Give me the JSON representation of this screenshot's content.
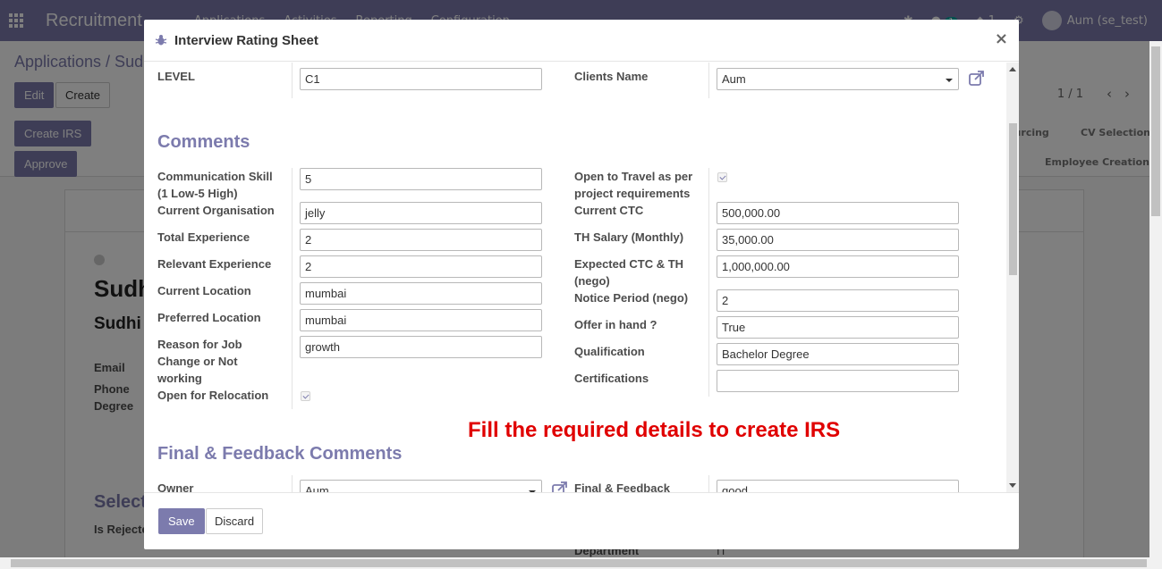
{
  "navbar": {
    "brand": "Recruitment",
    "menu": [
      "Applications",
      "Activities",
      "Reporting",
      "Configuration"
    ],
    "activity_count": "1",
    "message_count": "1",
    "user": "Aum (se_test)"
  },
  "control_panel": {
    "breadcrumb": "Applications / Sudh",
    "edit_label": "Edit",
    "create_label": "Create",
    "pager": "1 / 1",
    "create_irs_label": "Create IRS",
    "approve_label": "Approve",
    "stages": [
      "ourcing",
      "CV Selection",
      "Employee Creation"
    ]
  },
  "background_form": {
    "name_line1": "Sudh",
    "name_line2": "Sudhi",
    "email_label": "Email",
    "phone_label": "Phone",
    "degree_label": "Degree",
    "select_heading": "Select",
    "is_rejected_label": "Is Rejecte",
    "department_label": "Department",
    "department_value": "IT"
  },
  "modal": {
    "title": "Interview Rating Sheet",
    "close": "×",
    "level_label": "LEVEL",
    "level_value": "C1",
    "clients_name_label": "Clients Name",
    "clients_name_value": "Aum",
    "comments_title": "Comments",
    "left_fields": [
      {
        "label": "Communication Skill (1 Low-5 High)",
        "value": "5"
      },
      {
        "label": "Current Organisation",
        "value": "jelly"
      },
      {
        "label": "Total Experience",
        "value": "2"
      },
      {
        "label": "Relevant Experience",
        "value": "2"
      },
      {
        "label": "Current Location",
        "value": "mumbai"
      },
      {
        "label": "Preferred Location",
        "value": "mumbai"
      },
      {
        "label": "Reason for Job Change or Not working",
        "value": "growth"
      },
      {
        "label": "Open for Relocation",
        "value": true
      }
    ],
    "right_fields": [
      {
        "label": "Open to Travel as per project requirements",
        "value": true
      },
      {
        "label": "Current CTC",
        "value": "500,000.00"
      },
      {
        "label": "TH Salary (Monthly)",
        "value": "35,000.00"
      },
      {
        "label": "Expected CTC & TH (nego)",
        "value": "1,000,000.00"
      },
      {
        "label": "Notice Period (nego)",
        "value": "2"
      },
      {
        "label": "Offer in hand ?",
        "value": "True"
      },
      {
        "label": "Qualification",
        "value": "Bachelor Degree"
      },
      {
        "label": "Certifications",
        "value": ""
      }
    ],
    "notice": "Fill the required details to create IRS",
    "final_title": "Final & Feedback Comments",
    "owner_label": "Owner",
    "owner_value": "Aum",
    "final_feedback_label": "Final & Feedback",
    "final_feedback_value": "good",
    "save_label": "Save",
    "discard_label": "Discard"
  },
  "colors": {
    "brand": "#7c7bad",
    "notice": "#e00000",
    "accent": "#00a09d"
  }
}
